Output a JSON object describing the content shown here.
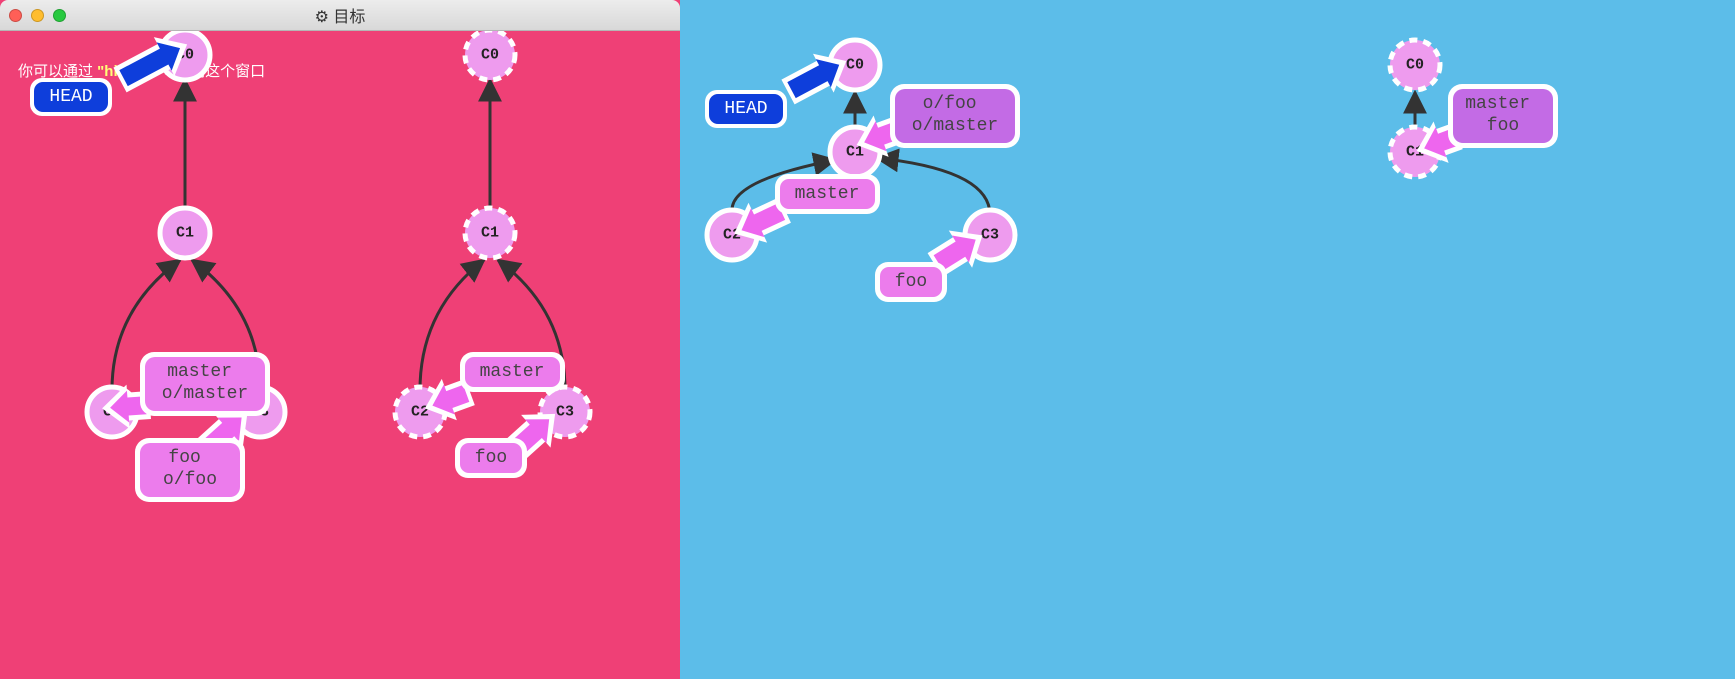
{
  "window": {
    "title": "目标",
    "gear_icon": "⚙"
  },
  "hint": {
    "prefix": "你可以通过 ",
    "kw": "\"hid",
    "suffix": "令关闭这个窗口"
  },
  "head_label": "HEAD",
  "goal_local": {
    "c0": "C0",
    "c1": "C1",
    "c2": "C2",
    "c3": "C3",
    "master_tag": "master\no/master",
    "foo_tag": "foo\no/foo"
  },
  "goal_remote": {
    "c0": "C0",
    "c1": "C1",
    "c2": "C2",
    "c3": "C3",
    "master_tag": "master",
    "foo_tag": "foo"
  },
  "current_local": {
    "c0": "C0",
    "c1": "C1",
    "c2": "C2",
    "c3": "C3",
    "remote_tag": "o/foo\no/master",
    "master_tag": "master",
    "foo_tag": "foo"
  },
  "current_remote": {
    "c0": "C0",
    "c1": "C1",
    "branch_tag": "master\nfoo"
  }
}
